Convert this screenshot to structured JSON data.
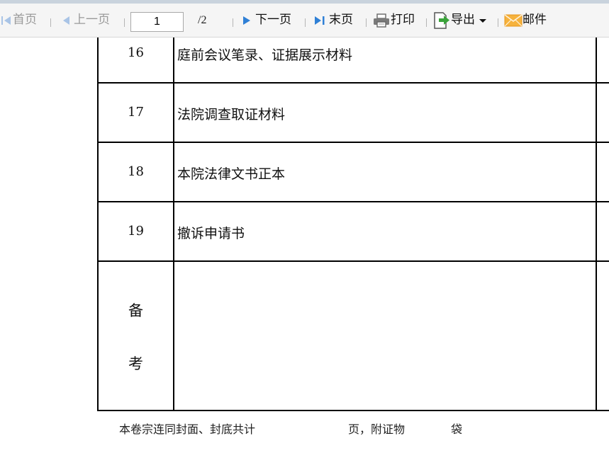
{
  "toolbar": {
    "first_page": "首页",
    "prev_page": "上一页",
    "current_page": "1",
    "total_pages": "/2",
    "next_page": "下一页",
    "last_page": "末页",
    "print": "打印",
    "export": "导出",
    "mail": "邮件"
  },
  "table": {
    "rows": [
      {
        "num": "16",
        "text": "庭前会议笔录、证据展示材料"
      },
      {
        "num": "17",
        "text": "法院调查取证材料"
      },
      {
        "num": "18",
        "text": "本院法律文书正本"
      },
      {
        "num": "19",
        "text": "撤诉申请书"
      }
    ],
    "remark_label_1": "备",
    "remark_label_2": "考"
  },
  "footer": {
    "part1": "本卷宗连同封面、封底共计",
    "part2": "页，附证物",
    "part3": "袋"
  },
  "colors": {
    "nav_arrow": "#2f80d6",
    "export_icon": "#3aa33a",
    "mail_icon": "#f0a020"
  }
}
